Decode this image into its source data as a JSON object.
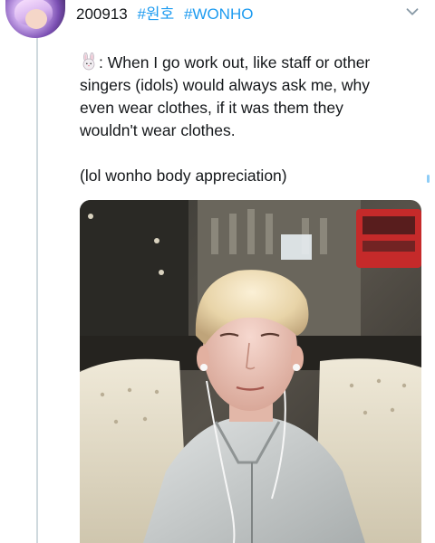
{
  "tweet": {
    "date": "200913",
    "hashtags": [
      "#원호",
      "#WONHO"
    ],
    "emoji": "rabbit-emoji",
    "lines": [
      ": When I go work out, like staff or other",
      "singers (idols) would always ask me, why",
      "even wear clothes, if it was them they",
      "wouldn't wear clothes."
    ],
    "note": "(lol wonho body appreciation)"
  },
  "colors": {
    "hashtag": "#1d9bf0",
    "text": "#14171a",
    "thread_line": "#cfd9de"
  },
  "icons": [
    "chevron-down-icon",
    "rabbit-emoji"
  ]
}
